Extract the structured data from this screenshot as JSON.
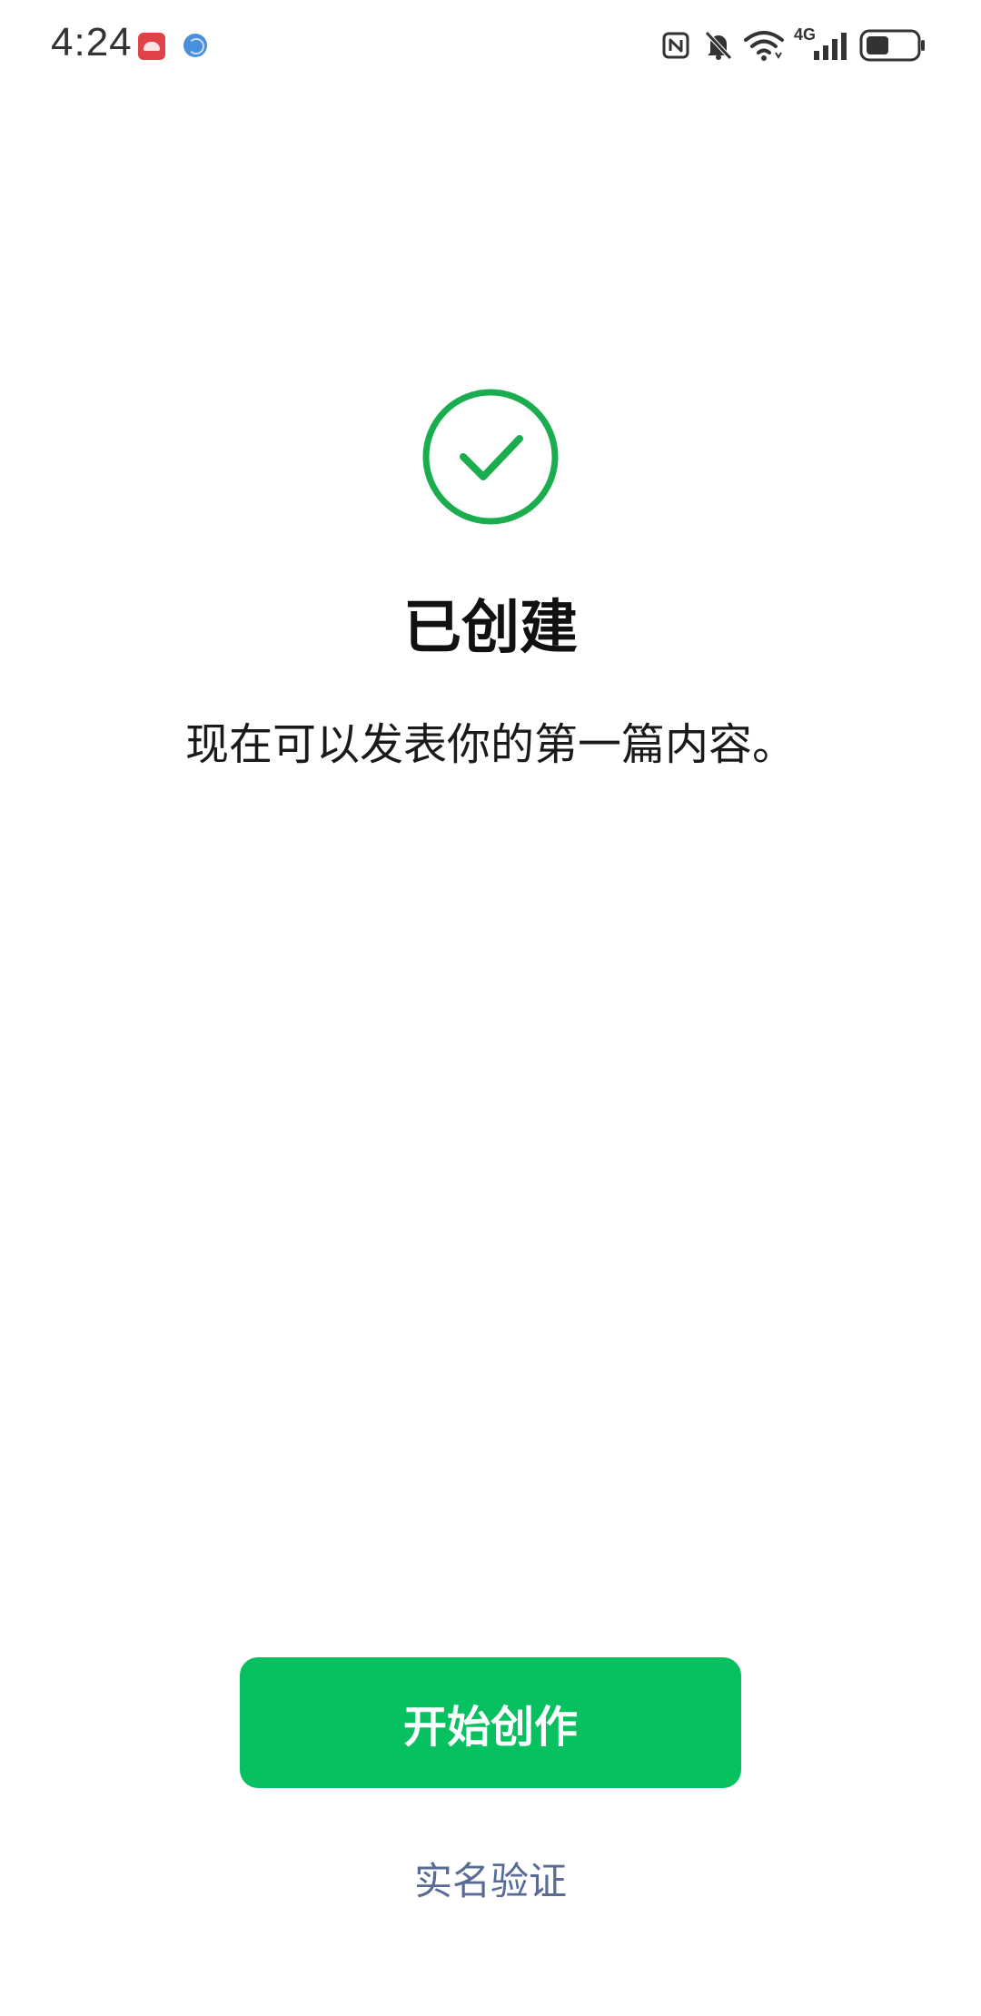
{
  "status_bar": {
    "time": "4:24",
    "network": "4G",
    "icons": [
      "huawei-app-icon",
      "browser-icon",
      "nfc-icon",
      "mute-bell-icon",
      "wifi-icon",
      "signal-icon",
      "battery-icon"
    ]
  },
  "success": {
    "icon": "check-circle-icon",
    "title": "已创建",
    "message": "现在可以发表你的第一篇内容。"
  },
  "actions": {
    "primary_label": "开始创作",
    "secondary_label": "实名验证"
  },
  "colors": {
    "accent": "#07c160",
    "check": "#1aad4e",
    "link": "#576b95"
  }
}
